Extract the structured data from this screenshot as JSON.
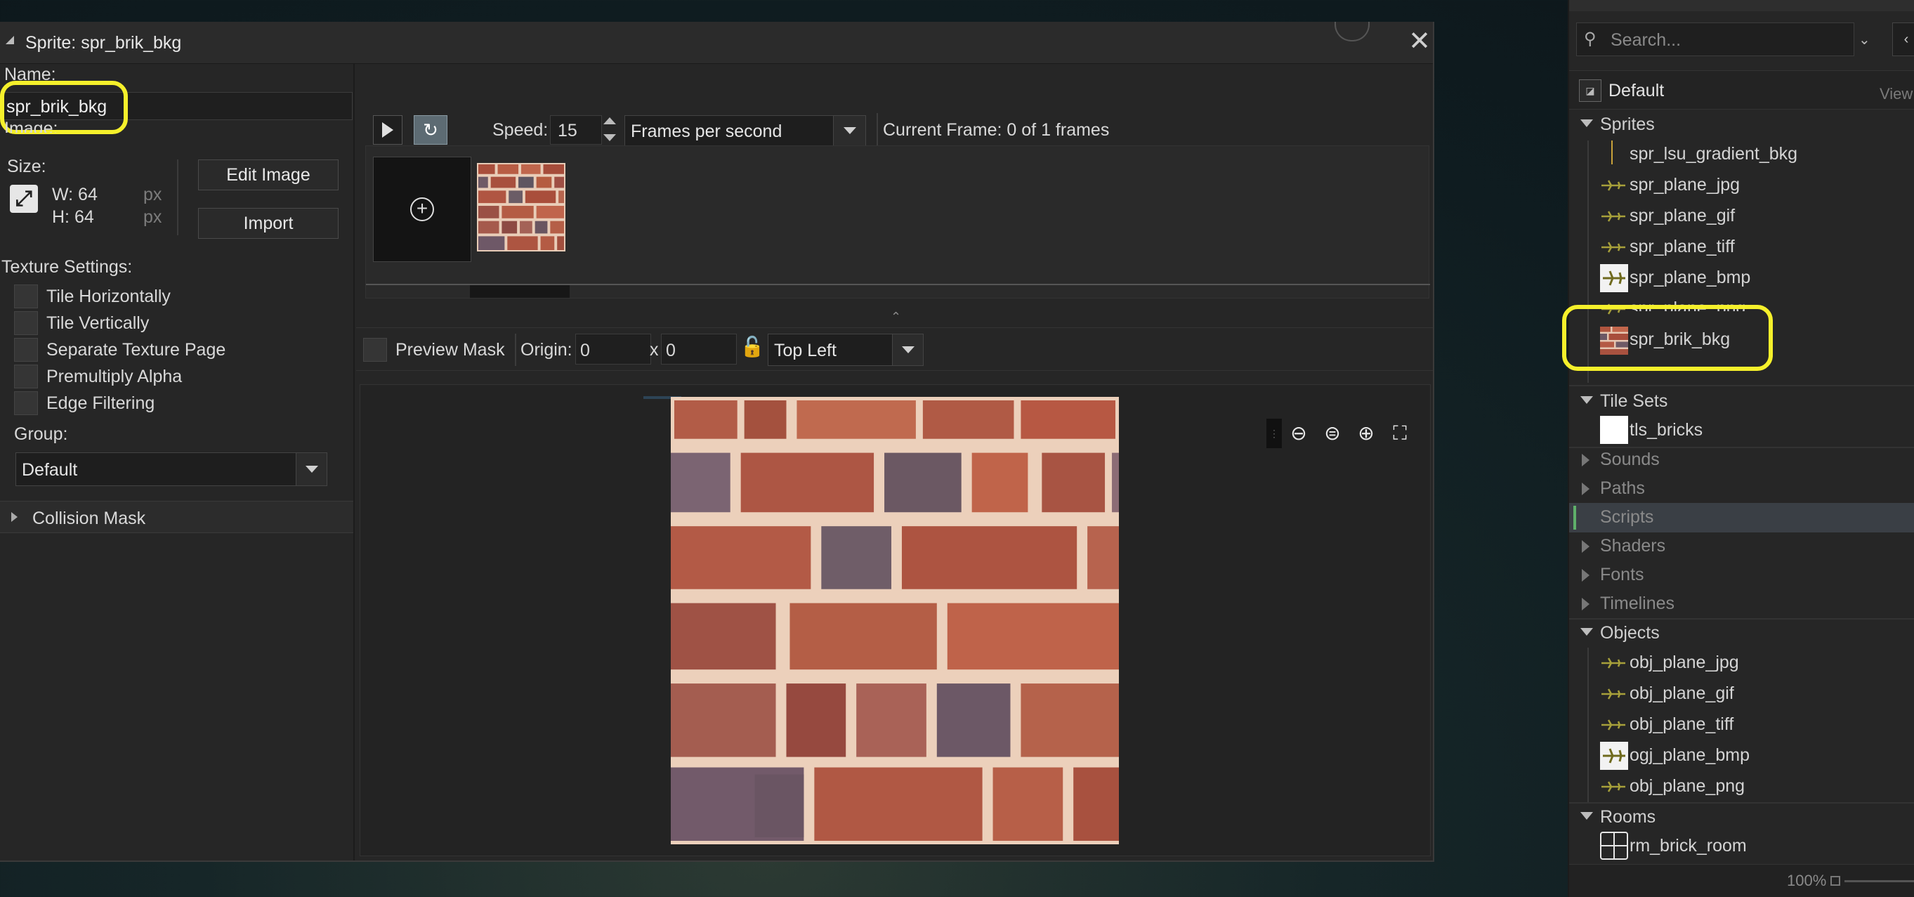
{
  "window": {
    "title": "Sprite: spr_brik_bkg",
    "close_icon": "close-icon"
  },
  "left": {
    "name_label": "Name:",
    "name_value": "spr_brik_bkg",
    "image_label": "Image:",
    "size_label": "Size:",
    "width_label": "W: 64",
    "height_label": "H: 64",
    "px1": "px",
    "px2": "px",
    "edit_image": "Edit Image",
    "import": "Import",
    "texture_settings": "Texture Settings:",
    "checkboxes": [
      "Tile Horizontally",
      "Tile Vertically",
      "Separate Texture Page",
      "Premultiply Alpha",
      "Edge Filtering"
    ],
    "group_label": "Group:",
    "group_value": "Default",
    "collision_mask": "Collision Mask"
  },
  "toolbar": {
    "speed_label": "Speed:",
    "speed_value": "15",
    "speed_unit": "Frames per second",
    "current_frame": "Current Frame: 0 of 1 frames"
  },
  "preview": {
    "preview_mask": "Preview Mask",
    "origin_label": "Origin:",
    "origin_x": "0",
    "x_sep": "x",
    "origin_y": "0",
    "origin_preset": "Top Left"
  },
  "assets": {
    "search_placeholder": "Search...",
    "default_label": "Default",
    "view_label": "View",
    "sprites_header": "Sprites",
    "sprites": [
      "spr_lsu_gradient_bkg",
      "spr_plane_jpg",
      "spr_plane_gif",
      "spr_plane_tiff",
      "spr_plane_bmp",
      "spr_plane_png",
      "spr_brik_bkg"
    ],
    "tilesets_header": "Tile Sets",
    "tilesets": [
      "tls_bricks"
    ],
    "sounds": "Sounds",
    "paths": "Paths",
    "scripts": "Scripts",
    "shaders": "Shaders",
    "fonts": "Fonts",
    "timelines": "Timelines",
    "objects_header": "Objects",
    "objects": [
      "obj_plane_jpg",
      "obj_plane_gif",
      "obj_plane_tiff",
      "ogj_plane_bmp",
      "obj_plane_png"
    ],
    "rooms_header": "Rooms",
    "rooms": [
      "rm_brick_room"
    ],
    "zoom": "100%"
  },
  "colors": {
    "highlight": "#f5f02b",
    "panel": "#262626",
    "accent_green": "#5fb06a"
  }
}
